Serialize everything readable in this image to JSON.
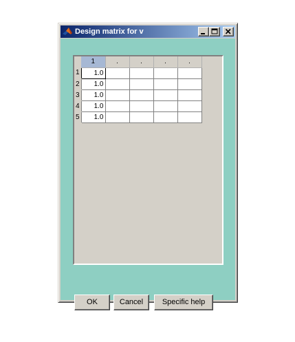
{
  "window": {
    "title": "Design matrix for v",
    "icon": "matlab-logo-icon",
    "controls": [
      "minimize-icon",
      "maximize-icon",
      "close-icon"
    ]
  },
  "table": {
    "column_headers": [
      "1",
      ".",
      ".",
      ".",
      "."
    ],
    "row_headers": [
      "1",
      "2",
      "3",
      "4",
      "5"
    ],
    "rows": [
      [
        "1.0",
        "",
        "",
        "",
        ""
      ],
      [
        "1.0",
        "",
        "",
        "",
        ""
      ],
      [
        "1.0",
        "",
        "",
        "",
        ""
      ],
      [
        "1.0",
        "",
        "",
        "",
        ""
      ],
      [
        "1.0",
        "",
        "",
        "",
        ""
      ]
    ]
  },
  "buttons": {
    "ok_label": "OK",
    "cancel_label": "Cancel",
    "help_label": "Specific help"
  },
  "colors": {
    "client_background": "#8ecfc2",
    "titlebar_start": "#0a246a",
    "titlebar_end": "#a6caf0",
    "active_column_header": "#a6b8d4"
  }
}
